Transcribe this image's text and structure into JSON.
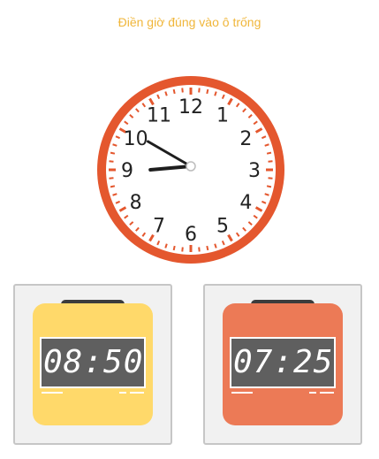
{
  "header": {
    "instruction": "Điền giờ đúng vào ô trống"
  },
  "clock": {
    "numbers": [
      "12",
      "1",
      "2",
      "3",
      "4",
      "5",
      "6",
      "7",
      "8",
      "9",
      "10",
      "11"
    ],
    "time_shown": "08:50",
    "colors": {
      "rim": "#e4572e",
      "hands": "#1e1e1e",
      "ticks": "#e4572e"
    }
  },
  "options": [
    {
      "time": "08:50",
      "body_color": "#ffd96a"
    },
    {
      "time": "07:25",
      "body_color": "#ec7a56"
    }
  ]
}
